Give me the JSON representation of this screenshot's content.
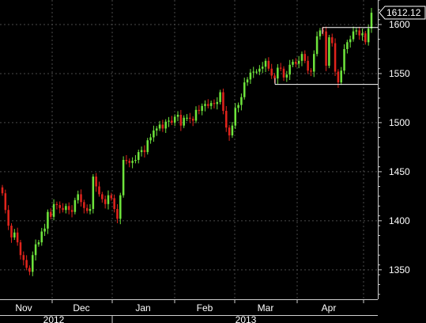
{
  "chart_data": {
    "type": "candlestick",
    "x_axis": {
      "months": [
        "Nov",
        "Dec",
        "Jan",
        "Feb",
        "Mar",
        "Apr"
      ],
      "years": [
        "2012",
        "2013"
      ]
    },
    "y_axis": {
      "side": "right",
      "ticks": [
        1350,
        1400,
        1450,
        1500,
        1550,
        1600
      ],
      "ylim": [
        1320,
        1625
      ]
    },
    "grid": true,
    "last_value_label": "1612.12",
    "resistance_line": 1597,
    "support_line": 1539,
    "colors": {
      "background": "#000000",
      "up": "#6ee43c",
      "down": "#e0241c",
      "grid": "#4a4a4a",
      "annotation": "#ffffff"
    },
    "closes": [
      1428,
      1411,
      1395,
      1383,
      1388,
      1378,
      1365,
      1360,
      1352,
      1348,
      1365,
      1376,
      1378,
      1389,
      1392,
      1409,
      1404,
      1417,
      1416,
      1413,
      1411,
      1415,
      1411,
      1409,
      1421,
      1427,
      1419,
      1413,
      1410,
      1412,
      1445,
      1435,
      1427,
      1422,
      1417,
      1426,
      1423,
      1412,
      1402,
      1426,
      1462,
      1461,
      1459,
      1461,
      1462,
      1470,
      1472,
      1470,
      1482,
      1485,
      1492,
      1494,
      1498,
      1494,
      1501,
      1502,
      1500,
      1506,
      1508,
      1497,
      1505,
      1505,
      1504,
      1502,
      1513,
      1512,
      1517,
      1519,
      1517,
      1520,
      1519,
      1521,
      1531,
      1512,
      1495,
      1487,
      1497,
      1515,
      1518,
      1526,
      1541,
      1544,
      1551,
      1552,
      1552,
      1555,
      1557,
      1563,
      1555,
      1548,
      1545,
      1556,
      1555,
      1546,
      1549,
      1559,
      1562,
      1560,
      1563,
      1570,
      1563,
      1553,
      1552,
      1570,
      1588,
      1594,
      1593,
      1558,
      1587,
      1581,
      1552,
      1541,
      1553,
      1575,
      1582,
      1585,
      1593,
      1594,
      1589,
      1591,
      1582,
      1596,
      1612
    ]
  }
}
